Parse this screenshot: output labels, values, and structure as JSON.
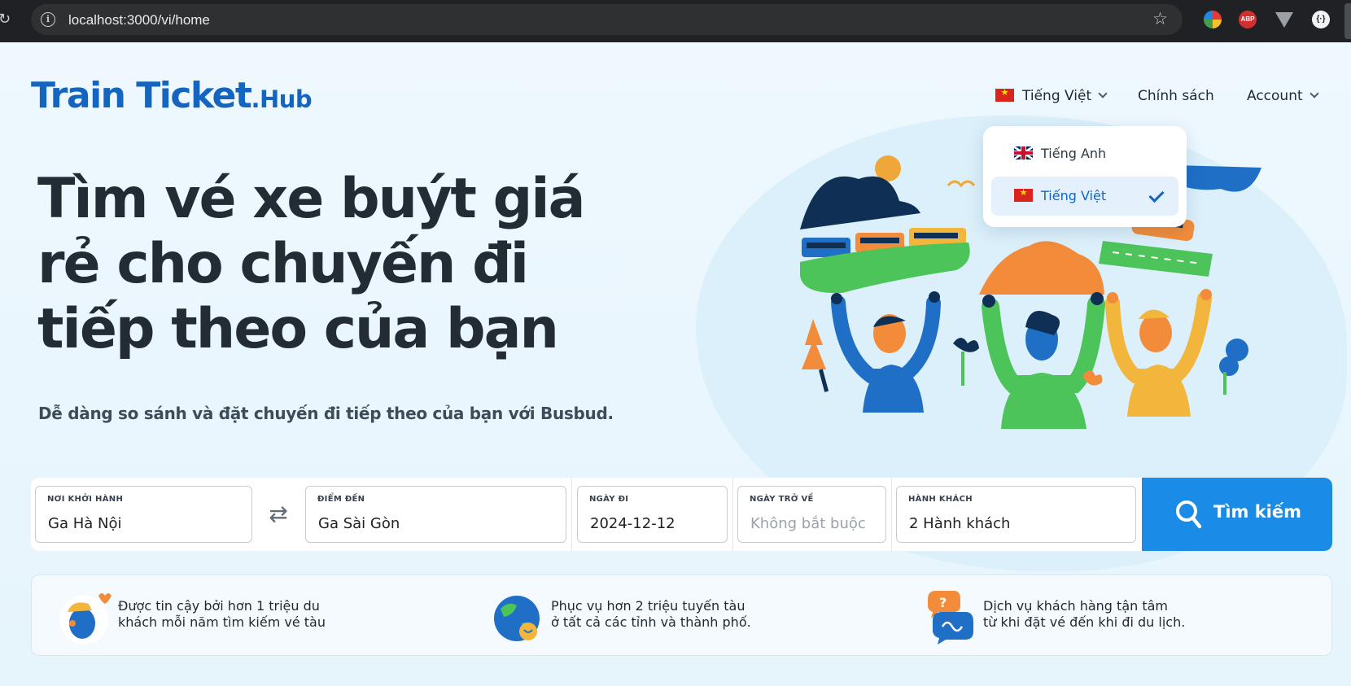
{
  "browser": {
    "url": "localhost:3000/vi/home"
  },
  "header": {
    "logo_main": "Train Ticket",
    "logo_suffix": ".Hub",
    "language_label": "Tiếng Việt",
    "policy_label": "Chính sách",
    "account_label": "Account"
  },
  "language_dropdown": {
    "items": [
      {
        "label": "Tiếng Anh",
        "flag": "uk-flag-icon",
        "selected": false
      },
      {
        "label": "Tiếng Việt",
        "flag": "vietnam-flag-icon",
        "selected": true
      }
    ]
  },
  "hero": {
    "line1": "Tìm vé xe buýt giá",
    "line2": "rẻ cho chuyến đi",
    "line3": "tiếp theo của bạn",
    "subtitle": "Dễ dàng so sánh và đặt chuyến đi tiếp theo của bạn với Busbud."
  },
  "search": {
    "origin_label": "NƠI KHỞI HÀNH",
    "origin_value": "Ga Hà Nội",
    "destination_label": "ĐIỂM ĐẾN",
    "destination_value": "Ga Sài Gòn",
    "departure_label": "NGÀY ĐI",
    "departure_value": "2024-12-12",
    "return_label": "NGÀY TRỞ VỀ",
    "return_placeholder": "Không bắt buộc",
    "passengers_label": "HÀNH KHÁCH",
    "passengers_value": "2 Hành khách",
    "button_label": "Tìm kiếm"
  },
  "features": [
    {
      "line1": "Được tin cậy bởi hơn 1 triệu du",
      "line2": "khách mỗi năm tìm kiếm vé tàu"
    },
    {
      "line1": "Phục vụ hơn 2 triệu tuyến tàu",
      "line2": "ở tất cả các tỉnh và thành phố."
    },
    {
      "line1": "Dịch vụ khách hàng tận tâm",
      "line2": "từ khi đặt vé đến khi đi du lịch."
    }
  ],
  "colors": {
    "brand_blue": "#1565c0",
    "button_blue": "#1a8ce8",
    "page_background": "#eaf6fd"
  }
}
